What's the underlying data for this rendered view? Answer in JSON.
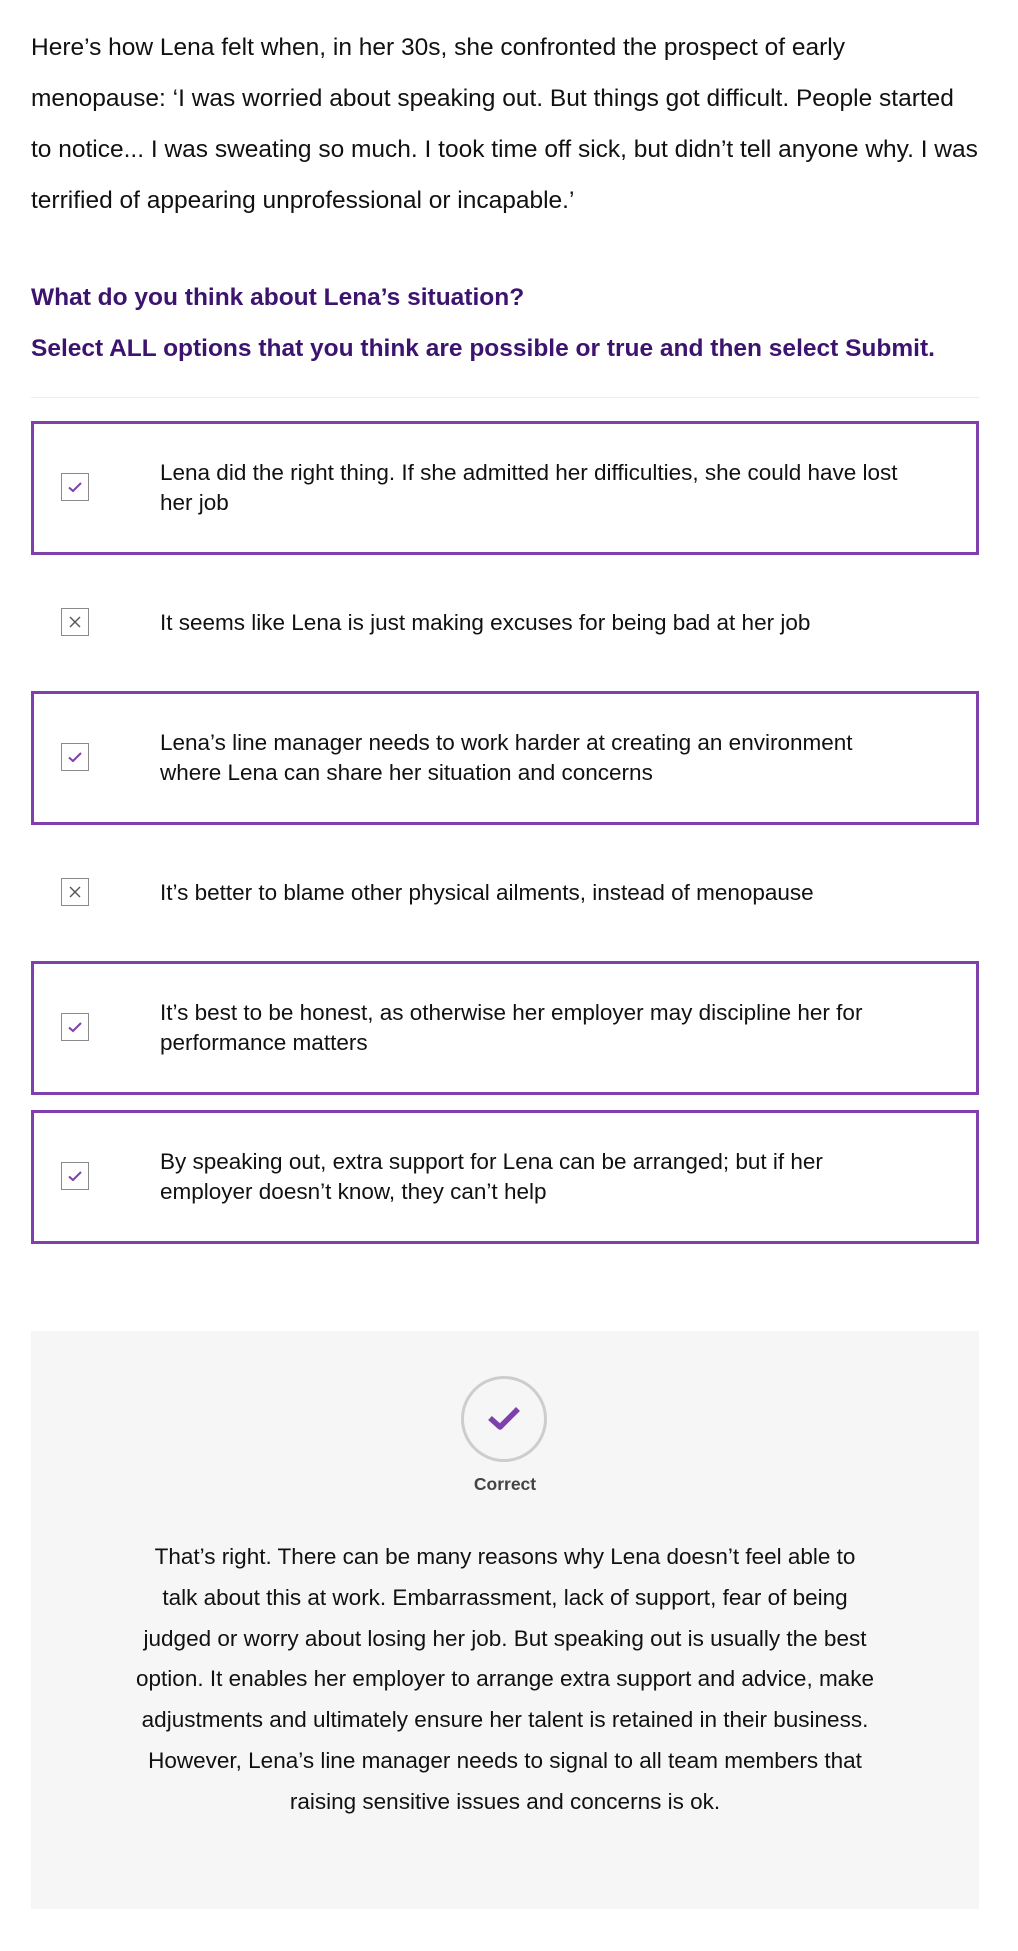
{
  "intro": {
    "text": "Here’s how Lena felt when, in her 30s, she confronted the prospect of early menopause: ‘I was worried about speaking out. But things got difficult. People started to notice... I was sweating so much. I took time off sick, but didn’t tell anyone why. I was terrified of appearing unprofessional or incapable.’"
  },
  "question": {
    "prompt": "What do you think about Lena’s situation?",
    "instruction": "Select ALL options that you think are possible or true and then select Submit."
  },
  "options": [
    {
      "label": "Lena did the right thing. If she admitted her difficulties, she could have lost her job",
      "state": "checked"
    },
    {
      "label": "It seems like Lena is just making excuses for being bad at her job",
      "state": "crossed"
    },
    {
      "label": "Lena’s line manager needs to work harder at creating an environment where Lena can share her situation and concerns",
      "state": "checked"
    },
    {
      "label": "It’s better to blame other physical ailments, instead of menopause",
      "state": "crossed"
    },
    {
      "label": "It’s best to be honest, as otherwise her employer may discipline her for performance matters",
      "state": "checked"
    },
    {
      "label": "By speaking out, extra support for Lena can be arranged; but if her employer doesn’t know, they can’t help",
      "state": "checked"
    }
  ],
  "feedback": {
    "icon": "checkmark-icon",
    "status": "Correct",
    "body": "That’s right. There can be many reasons why Lena doesn’t feel able to talk about this at work. Embarrassment, lack of support, fear of being judged or worry about losing her job. But speaking out is usually the best option. It enables her employer to arrange extra support and advice, make adjustments and ultimately ensure her talent is retained in their business.  However, Lena’s line manager needs to signal to all team members that raising sensitive issues and concerns is ok."
  },
  "colors": {
    "accent": "#7f3fac",
    "heading": "#3d1370",
    "feedback_bg": "#f6f6f6"
  }
}
